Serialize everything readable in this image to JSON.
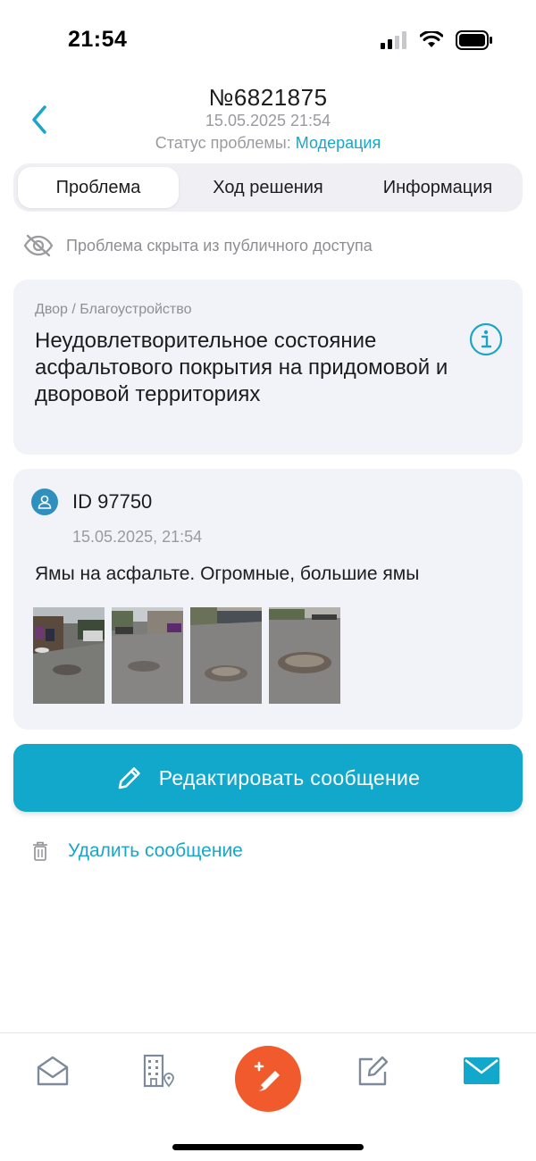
{
  "status_bar": {
    "time": "21:54"
  },
  "header": {
    "number": "№6821875",
    "date": "15.05.2025 21:54",
    "status_label": "Статус проблемы:",
    "status_value": "Модерация"
  },
  "tabs": [
    {
      "label": "Проблема",
      "active": true
    },
    {
      "label": "Ход решения",
      "active": false
    },
    {
      "label": "Информация",
      "active": false
    }
  ],
  "visibility_notice": "Проблема скрыта из публичного доступа",
  "problem_card": {
    "category": "Двор / Благоустройство",
    "title": "Неудовлетворительное состояние асфальтового покрытия на придомовой и дворовой территориях"
  },
  "message": {
    "author": "ID 97750",
    "date": "15.05.2025, 21:54",
    "text": "Ямы на асфальте. Огромные, большие ямы",
    "photo_count": 4
  },
  "actions": {
    "edit_label": "Редактировать сообщение",
    "delete_label": "Удалить сообщение"
  },
  "nav": [
    "home-icon",
    "building-location-icon",
    "new-problem-icon",
    "edit-icon",
    "mail-icon"
  ],
  "colors": {
    "accent": "#12a8cb",
    "link": "#1aa5c9",
    "fab": "#f05a2c",
    "card": "#f2f3f8"
  }
}
